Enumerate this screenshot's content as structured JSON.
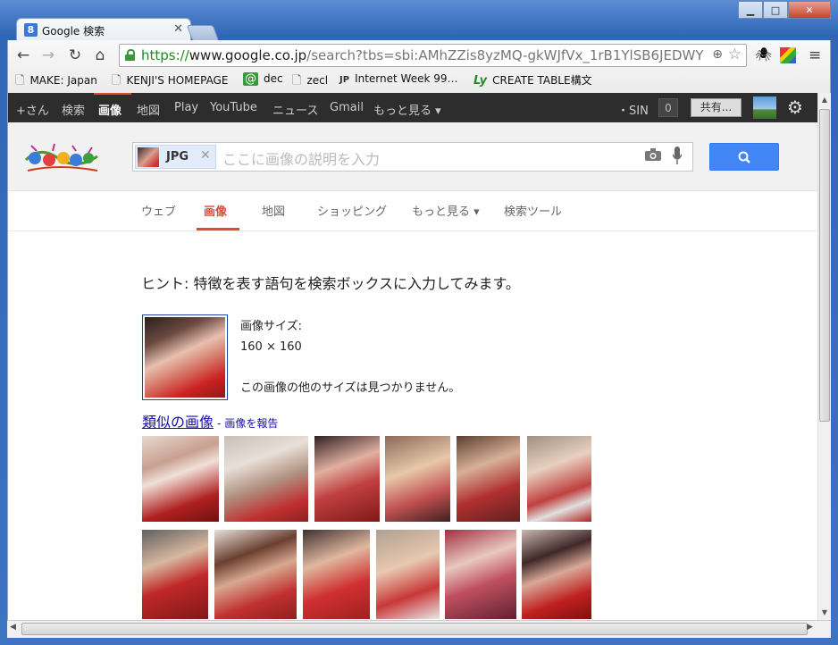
{
  "window": {
    "tab_title": "Google 検索",
    "tab_favicon": "8",
    "minimize": "▁",
    "maximize": "□",
    "close": "✕"
  },
  "toolbar": {
    "url_scheme": "https://",
    "url_host": "www.google.co.jp",
    "url_rest": "/search?tbs=sbi:AMhZZis8yzMQ-gkWJfVx_1rB1YlSB6JEDWY"
  },
  "bookmarks": [
    {
      "label": "MAKE: Japan",
      "icon": "page-icon"
    },
    {
      "label": "KENJI'S HOMEPAGE",
      "icon": "page-icon"
    },
    {
      "label": "dec",
      "icon": "at-icon"
    },
    {
      "label": "zecl",
      "icon": "page-icon"
    },
    {
      "label": "Internet Week 99…",
      "icon": "jpnic-icon"
    },
    {
      "label": "CREATE TABLE構文",
      "icon": "ly-icon"
    }
  ],
  "gbar": {
    "items": [
      "+さん",
      "検索",
      "画像",
      "地図",
      "Play",
      "YouTube",
      "ニュース",
      "Gmail",
      "もっと見る ▾"
    ],
    "user": "・SIN",
    "notifications": "0",
    "share": "共有..."
  },
  "search": {
    "chip_label": "JPG",
    "placeholder": "ここに画像の説明を入力"
  },
  "tabs": [
    "ウェブ",
    "画像",
    "地図",
    "ショッピング",
    "もっと見る ▾",
    "検索ツール"
  ],
  "content": {
    "hint": "ヒント: 特徴を表す語句を検索ボックスに入力してみます。",
    "size_label": "画像サイズ:",
    "size_value": "160 × 160",
    "no_other_sizes": "この画像の他のサイズは見つかりません。",
    "similar_link": "類似の画像",
    "report_link": "画像を報告"
  },
  "colors": {
    "accent_red": "#dd4b39",
    "search_blue": "#4285f4",
    "link_blue": "#1a0dab"
  }
}
